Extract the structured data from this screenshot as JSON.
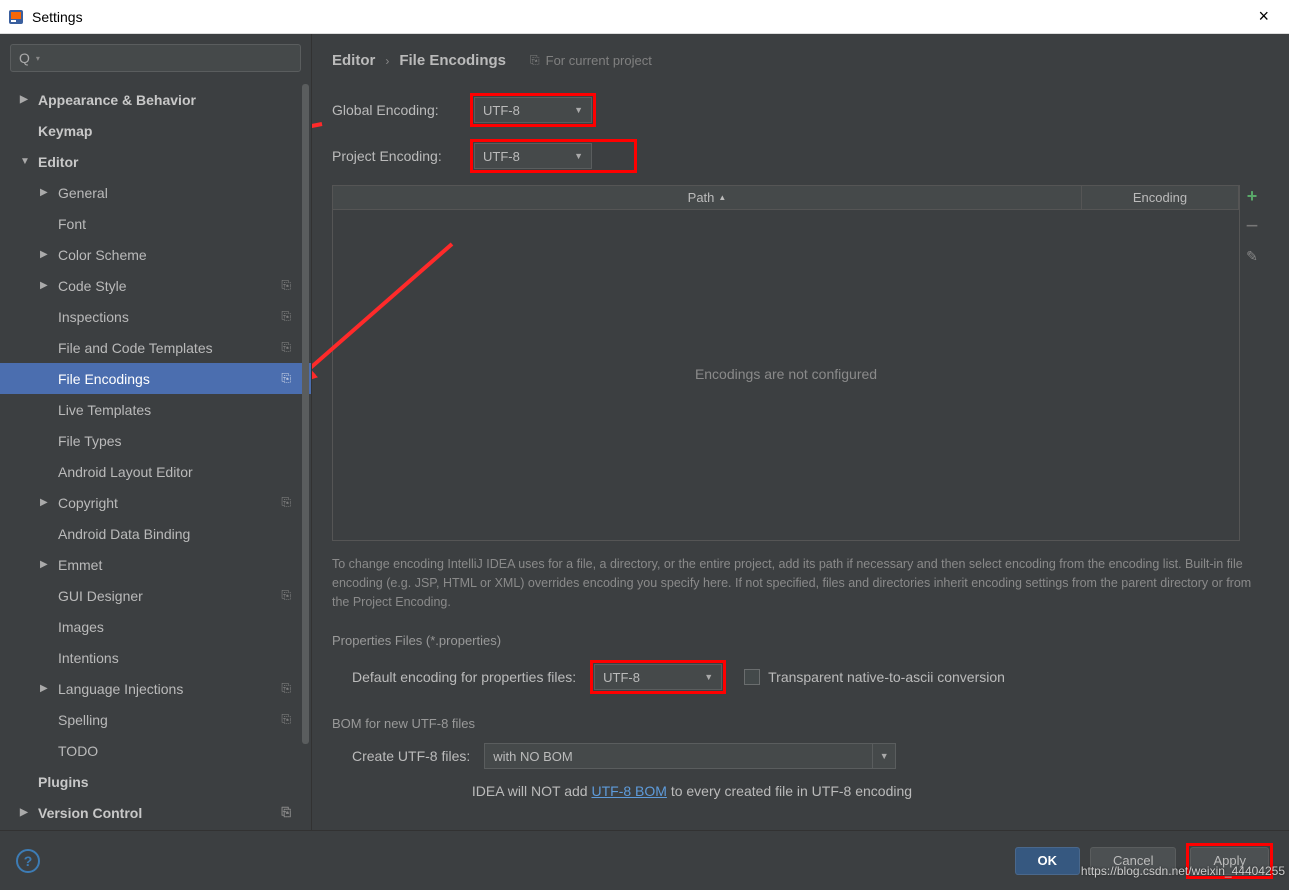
{
  "window": {
    "title": "Settings",
    "close": "×"
  },
  "search": {
    "placeholder": ""
  },
  "sidebar": {
    "items": [
      {
        "label": "Appearance & Behavior",
        "bold": true,
        "arrow": "▶",
        "level": 1
      },
      {
        "label": "Keymap",
        "bold": true,
        "level": 1
      },
      {
        "label": "Editor",
        "bold": true,
        "arrow": "▼",
        "level": 1
      },
      {
        "label": "General",
        "arrow": "▶",
        "level": 2
      },
      {
        "label": "Font",
        "level": 2
      },
      {
        "label": "Color Scheme",
        "arrow": "▶",
        "level": 2
      },
      {
        "label": "Code Style",
        "arrow": "▶",
        "level": 2,
        "badge": "⎘"
      },
      {
        "label": "Inspections",
        "level": 2,
        "badge": "⎘"
      },
      {
        "label": "File and Code Templates",
        "level": 2,
        "badge": "⎘"
      },
      {
        "label": "File Encodings",
        "level": 2,
        "badge": "⎘",
        "selected": true
      },
      {
        "label": "Live Templates",
        "level": 2
      },
      {
        "label": "File Types",
        "level": 2
      },
      {
        "label": "Android Layout Editor",
        "level": 2
      },
      {
        "label": "Copyright",
        "arrow": "▶",
        "level": 2,
        "badge": "⎘"
      },
      {
        "label": "Android Data Binding",
        "level": 2
      },
      {
        "label": "Emmet",
        "arrow": "▶",
        "level": 2
      },
      {
        "label": "GUI Designer",
        "level": 2,
        "badge": "⎘"
      },
      {
        "label": "Images",
        "level": 2
      },
      {
        "label": "Intentions",
        "level": 2
      },
      {
        "label": "Language Injections",
        "arrow": "▶",
        "level": 2,
        "badge": "⎘"
      },
      {
        "label": "Spelling",
        "level": 2,
        "badge": "⎘"
      },
      {
        "label": "TODO",
        "level": 2
      },
      {
        "label": "Plugins",
        "bold": true,
        "level": 1
      },
      {
        "label": "Version Control",
        "bold": true,
        "arrow": "▶",
        "level": 1,
        "badge": "⎘"
      }
    ]
  },
  "breadcrumb": {
    "part1": "Editor",
    "sep": "›",
    "part2": "File Encodings",
    "badge": "For current project"
  },
  "global": {
    "label": "Global Encoding:",
    "value": "UTF-8"
  },
  "project": {
    "label": "Project Encoding:",
    "value": "UTF-8"
  },
  "table": {
    "col1": "Path",
    "col2": "Encoding",
    "empty": "Encodings are not configured"
  },
  "help": "To change encoding IntelliJ IDEA uses for a file, a directory, or the entire project, add its path if necessary and then select encoding from the encoding list. Built-in file encoding (e.g. JSP, HTML or XML) overrides encoding you specify here. If not specified, files and directories inherit encoding settings from the parent directory or from the Project Encoding.",
  "props": {
    "section": "Properties Files (*.properties)",
    "label": "Default encoding for properties files:",
    "value": "UTF-8",
    "cb": "Transparent native-to-ascii conversion"
  },
  "bom": {
    "section": "BOM for new UTF-8 files",
    "label": "Create UTF-8 files:",
    "value": "with NO BOM",
    "text1": "IDEA will NOT add ",
    "link": "UTF-8 BOM",
    "text2": " to every created file in UTF-8 encoding"
  },
  "footer": {
    "ok": "OK",
    "cancel": "Cancel",
    "apply": "Apply"
  },
  "watermark": "https://blog.csdn.net/weixin_44404255"
}
